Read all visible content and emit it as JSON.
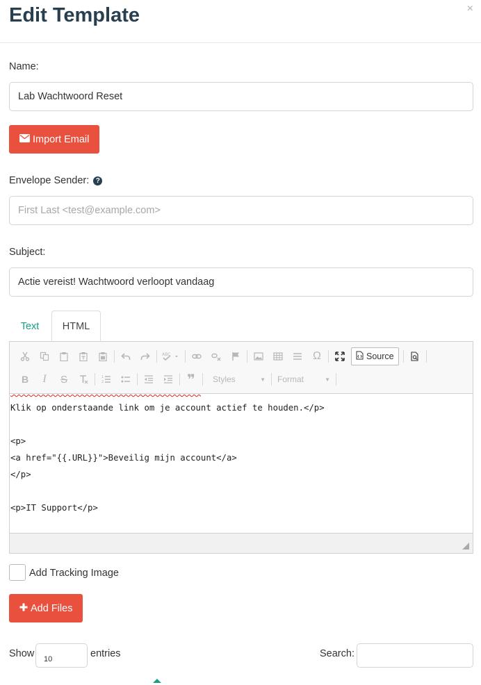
{
  "header": {
    "title": "Edit Template",
    "close_label": "×"
  },
  "form": {
    "name_label": "Name:",
    "name_value": "Lab Wachtwoord Reset",
    "import_email_label": "Import Email",
    "envelope_sender_label": "Envelope Sender:",
    "envelope_sender_placeholder": "First Last <test@example.com>",
    "subject_label": "Subject:",
    "subject_value": "Actie vereist! Wachtwoord verloopt vandaag"
  },
  "tabs": [
    {
      "label": "Text",
      "active": false
    },
    {
      "label": "HTML",
      "active": true
    }
  ],
  "editor": {
    "toolbar": {
      "source_label": "Source",
      "styles_label": "Styles",
      "format_label": "Format"
    },
    "code_lines": [
      "Klik op onderstaande link om je account actief te houden.</p>",
      "",
      "<p>",
      "<a href=\"{{.URL}}\">Beveilig mijn account</a>",
      "</p>",
      "",
      "<p>IT Support</p>"
    ]
  },
  "tracking": {
    "label": "Add Tracking Image",
    "checked": false
  },
  "add_files_label": "Add Files",
  "table_controls": {
    "show_label": "Show",
    "entries_value": "10",
    "entries_label": "entries",
    "search_label": "Search:"
  },
  "colors": {
    "primary_text": "#283f50",
    "danger": "#e9503d",
    "accent": "#1a9e84"
  }
}
